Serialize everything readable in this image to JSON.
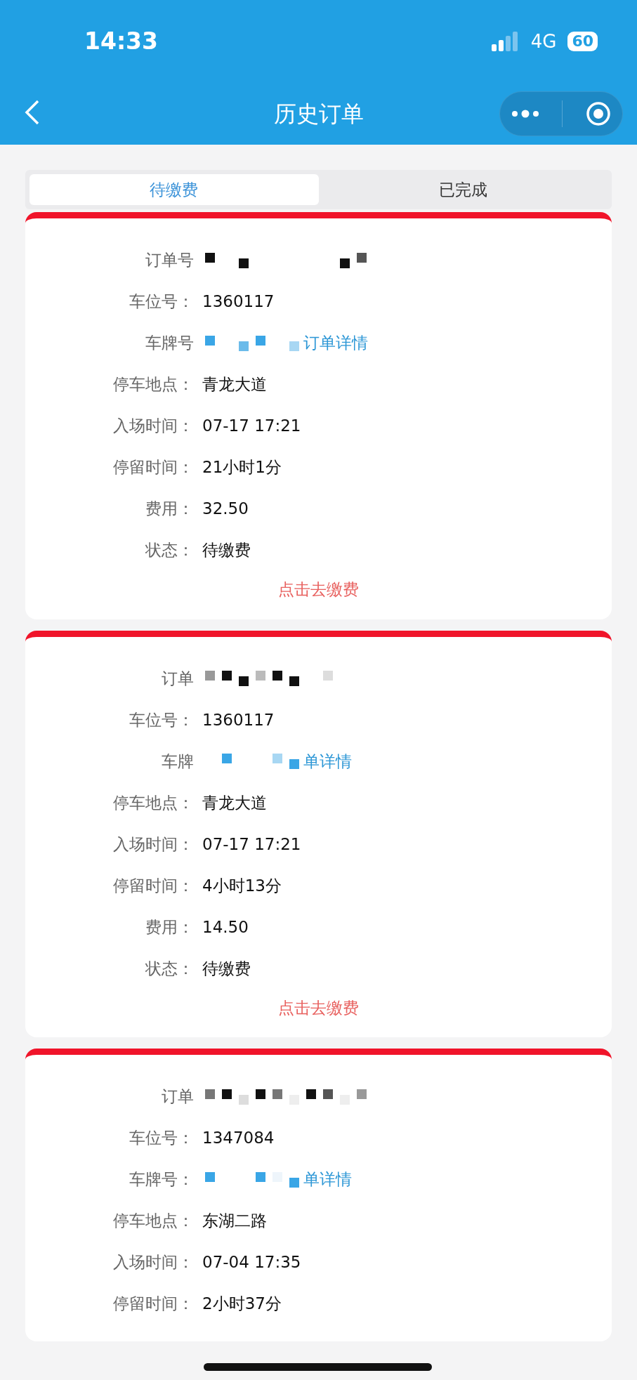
{
  "status_bar": {
    "time": "14:33",
    "network": "4G",
    "battery": "60"
  },
  "nav": {
    "title": "历史订单"
  },
  "tabs": [
    {
      "label": "待缴费",
      "selected": true
    },
    {
      "label": "已完成",
      "selected": false
    }
  ],
  "orders": [
    {
      "rows": [
        {
          "kind": "redacted",
          "label": "订单号"
        },
        {
          "kind": "text",
          "label": "车位号：",
          "value": "1360117"
        },
        {
          "kind": "redacted_link",
          "label": "车牌号",
          "link": "订单详情"
        },
        {
          "kind": "text",
          "label": "停车地点：",
          "value": "青龙大道"
        },
        {
          "kind": "text",
          "label": "入场时间：",
          "value": "07-17 17:21"
        },
        {
          "kind": "text",
          "label": "停留时间：",
          "value": "21小时1分"
        },
        {
          "kind": "text",
          "label": "费用：",
          "value": "32.50"
        },
        {
          "kind": "text",
          "label": "状态：",
          "value": "待缴费"
        }
      ],
      "pay_button": "点击去缴费"
    },
    {
      "rows": [
        {
          "kind": "redacted",
          "label": "订单"
        },
        {
          "kind": "text",
          "label": "车位号：",
          "value": "1360117"
        },
        {
          "kind": "redacted_link",
          "label": "车牌",
          "link": "单详情"
        },
        {
          "kind": "text",
          "label": "停车地点：",
          "value": "青龙大道"
        },
        {
          "kind": "text",
          "label": "入场时间：",
          "value": "07-17 17:21"
        },
        {
          "kind": "text",
          "label": "停留时间：",
          "value": "4小时13分"
        },
        {
          "kind": "text",
          "label": "费用：",
          "value": "14.50"
        },
        {
          "kind": "text",
          "label": "状态：",
          "value": "待缴费"
        }
      ],
      "pay_button": "点击去缴费"
    },
    {
      "rows": [
        {
          "kind": "redacted",
          "label": "订单"
        },
        {
          "kind": "text",
          "label": "车位号：",
          "value": "1347084"
        },
        {
          "kind": "redacted_link",
          "label": "车牌号：",
          "link": "单详情"
        },
        {
          "kind": "text",
          "label": "停车地点：",
          "value": "东湖二路"
        },
        {
          "kind": "text",
          "label": "入场时间：",
          "value": "07-04 17:35"
        },
        {
          "kind": "text",
          "label": "停留时间：",
          "value": "2小时37分"
        }
      ]
    }
  ]
}
